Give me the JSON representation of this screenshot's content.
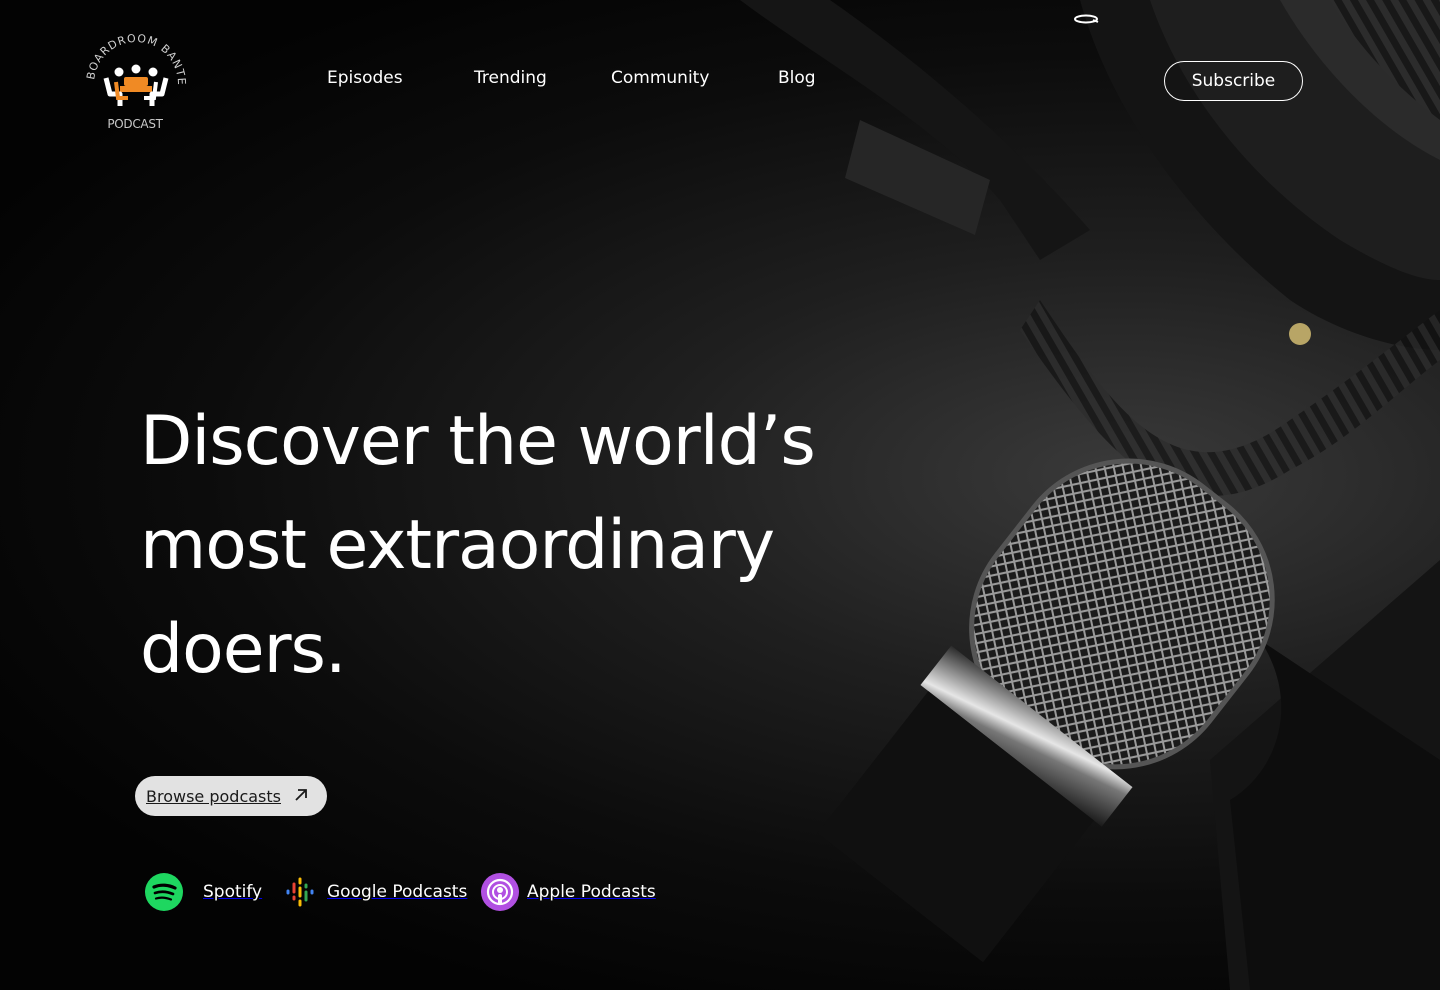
{
  "brand": {
    "ring_text": "BOARDROOM BANTER",
    "caption": "PODCAST",
    "accent": "#f08a24"
  },
  "nav": {
    "items": [
      "Episodes",
      "Trending",
      "Community",
      "Blog"
    ],
    "subscribe_label": "Subscribe"
  },
  "hero": {
    "headline_lines": [
      "Discover the world’s",
      "most extraordinary",
      "doers."
    ],
    "cta_label": "Browse podcasts",
    "cta_icon": "arrow-up-right-icon"
  },
  "platforms": [
    {
      "label": "Spotify",
      "icon": "spotify-icon",
      "color": "#1ed760"
    },
    {
      "label": "Google Podcasts",
      "icon": "google-podcasts-icon",
      "color": "#4285f4"
    },
    {
      "label": "Apple Podcasts",
      "icon": "apple-podcasts-icon",
      "color": "#b150e2"
    }
  ]
}
